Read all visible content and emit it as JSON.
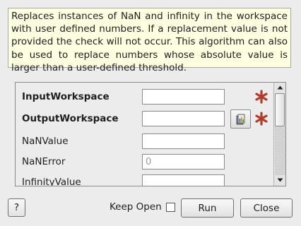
{
  "description": "Replaces instances of NaN and infinity in the workspace with user defined numbers. If a replacement value is not provided the check will not occur. This algorithm can also be used to replace numbers whose absolute value is larger than a user-defined threshold.",
  "properties": [
    {
      "label": "InputWorkspace",
      "bold": true,
      "value": "",
      "placeholder": "",
      "mandatory": true,
      "browse": false
    },
    {
      "label": "OutputWorkspace",
      "bold": true,
      "value": "",
      "placeholder": "",
      "mandatory": true,
      "browse": true
    },
    {
      "label": "NaNValue",
      "bold": false,
      "value": "",
      "placeholder": "",
      "mandatory": false,
      "browse": false
    },
    {
      "label": "NaNError",
      "bold": false,
      "value": "",
      "placeholder": "0",
      "mandatory": false,
      "browse": false
    },
    {
      "label": "InfinityValue",
      "bold": false,
      "value": "",
      "placeholder": "",
      "mandatory": false,
      "browse": false
    }
  ],
  "mandatory_marker_color": "#b43a2a",
  "footer": {
    "help_label": "?",
    "keep_open_label": "Keep Open",
    "keep_open_checked": false,
    "run_label": "Run",
    "close_label": "Close"
  }
}
